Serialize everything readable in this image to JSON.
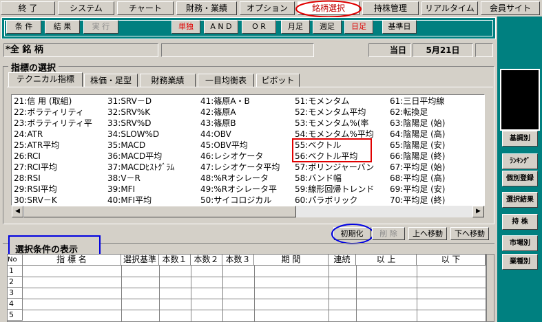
{
  "menu": [
    {
      "label": "終 了"
    },
    {
      "label": "システム"
    },
    {
      "label": "チャート"
    },
    {
      "label": "財務・業績"
    },
    {
      "label": "オプション"
    },
    {
      "label": "銘柄選択"
    },
    {
      "label": "持株管理"
    },
    {
      "label": "リアルタイム"
    },
    {
      "label": "会員サイト"
    }
  ],
  "toolbar": {
    "condition": "条 件",
    "result": "結 果",
    "execute": "実 行",
    "single": "単独",
    "and": "A N D",
    "or": "O R",
    "monthly": "月足",
    "weekly": "週足",
    "daily": "日足",
    "base_date": "基準日"
  },
  "info": {
    "stock": "*全 銘 柄",
    "today_label": "当日",
    "date": "5月21日"
  },
  "indicator_group": {
    "title": "指標の選択",
    "tabs": [
      "テクニカル指標",
      "株価・足型",
      "財務業績",
      "一目均衡表",
      "ピボット"
    ],
    "columns": [
      [
        "21:信 用 (取組)",
        "22:ボラティリティ",
        "23:ボラティリティ平",
        "24:ATR",
        "25:ATR平均",
        "26:RCI",
        "27:RCI平均",
        "28:RSI",
        "29:RSI平均",
        "30:SRV－K"
      ],
      [
        "31:SRV－D",
        "32:SRV%K",
        "33:SRV%D",
        "34:SLOW%D",
        "35:MACD",
        "36:MACD平均",
        "37:MACDﾋｽﾄｸﾞﾗﾑ",
        "38:V－R",
        "39:MFI",
        "40:MFI平均"
      ],
      [
        "41:篠原A・B",
        "42:篠原A",
        "43:篠原B",
        "44:OBV",
        "45:OBV平均",
        "46:レシオケータ",
        "47:レシオケータ平均",
        "48:%Rオシレータ",
        "49:%Rオシレータ平",
        "50:サイコロジカル"
      ],
      [
        "51:モメンタム",
        "52:モメンタム平均",
        "53:モメンタム%(率",
        "54:モメンタム%平均",
        "55:ベクトル",
        "56:ベクトル平均",
        "57:ボリンジャーバン",
        "58:バンド幅",
        "59:線形回帰トレンド",
        "60:パラボリック"
      ],
      [
        "61:三日平均線",
        "62:転換足",
        "63:陰陽足 (始)",
        "64:陰陽足 (高)",
        "65:陰陽足 (安)",
        "66:陰陽足 (終)",
        "67:平均足 (始)",
        "68:平均足 (高)",
        "69:平均足 (安)",
        "70:平均足 (終)"
      ]
    ]
  },
  "actions": {
    "init": "初期化",
    "delete": "削 除",
    "up": "上へ移動",
    "down": "下へ移動"
  },
  "conditions": {
    "title": "選択条件の表示",
    "headers": [
      "No",
      "指 標 名",
      "選択基準",
      "本数１",
      "本数２",
      "本数３",
      "期 間",
      "連続",
      "以 上",
      "以 下"
    ],
    "rows": [
      "1",
      "2",
      "3",
      "4",
      "5"
    ]
  },
  "side_buttons": [
    "基調別",
    "ﾗﾝｷﾝｸﾞ",
    "個別登録",
    "選択結果",
    "持 株",
    "市場別",
    "業種別"
  ],
  "colors": {
    "teal": "#008080",
    "highlight_red": "#e00000",
    "highlight_blue": "#0000e0"
  }
}
